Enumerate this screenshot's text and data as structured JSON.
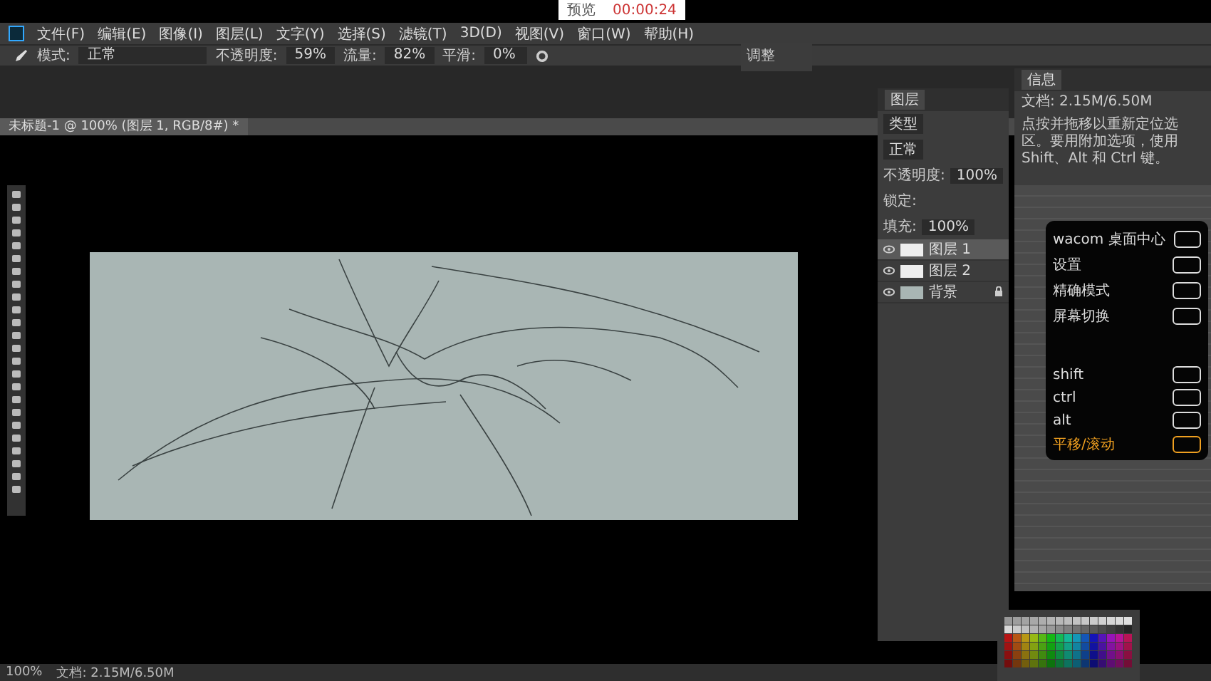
{
  "preview_popup": {
    "title": "预览",
    "timestamp": "00:00:24"
  },
  "menu": [
    "文件(F)",
    "编辑(E)",
    "图像(I)",
    "图层(L)",
    "文字(Y)",
    "选择(S)",
    "滤镜(T)",
    "3D(D)",
    "视图(V)",
    "窗口(W)",
    "帮助(H)"
  ],
  "options": {
    "mode_label": "模式:",
    "mode": "正常",
    "opacity_label": "不透明度:",
    "opacity": "59%",
    "flow_label": "流量:",
    "flow": "82%",
    "smooth_label": "平滑:",
    "smooth": "0%"
  },
  "adjust_panel": {
    "title": "调整"
  },
  "document_tab": "未标题-1 @ 100% (图层 1, RGB/8#) *",
  "layers_panel": {
    "title": "图层",
    "filter": "类型",
    "blend": "正常",
    "opacity_label": "不透明度:",
    "opacity": "100%",
    "lock_label": "锁定:",
    "fill_label": "填充:",
    "fill": "100%",
    "layers": [
      {
        "name": "图层 1",
        "selected": true,
        "locked": false
      },
      {
        "name": "图层 2",
        "selected": false,
        "locked": false
      },
      {
        "name": "背景",
        "selected": false,
        "locked": true
      }
    ]
  },
  "info_panel": {
    "title": "信息",
    "doc": "文档: 2.15M/6.50M",
    "hint": "点按并拖移以重新定位选区。要用附加选项，使用 Shift、Alt 和 Ctrl 键。"
  },
  "wacom": {
    "items": [
      {
        "label": "wacom 桌面中心",
        "selected": false
      },
      {
        "label": "设置",
        "selected": false
      },
      {
        "label": "精确模式",
        "selected": false
      },
      {
        "label": "屏幕切换",
        "selected": false
      },
      {
        "label": "shift",
        "selected": false
      },
      {
        "label": "ctrl",
        "selected": false
      },
      {
        "label": "alt",
        "selected": false
      },
      {
        "label": "平移/滚动",
        "selected": true
      }
    ]
  },
  "status_bar": {
    "zoom": "100%",
    "doc": "文档: 2.15M/6.50M"
  }
}
